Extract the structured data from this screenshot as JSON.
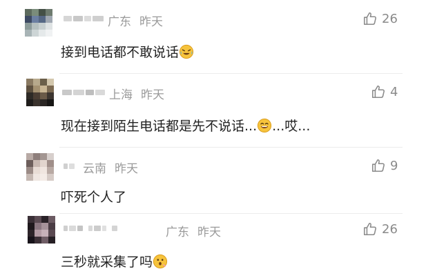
{
  "comments": [
    {
      "location": "广东",
      "time": "昨天",
      "likes": "26",
      "text": "接到电话都不敢说话",
      "emoji": "crying-laughing-emoji",
      "avatar_colors": [
        "#5d6b5e",
        "#7a8c7b",
        "#445046",
        "#6e7b6f",
        "#3d4a63",
        "#6b7fa2",
        "#566885",
        "#a0a8b2",
        "#8c9b9a",
        "#b5c0c0",
        "#c7cfd0",
        "#dfe3e4",
        "#a8b4b6",
        "#cdd5d6",
        "#e5e9ea",
        "#f0f2f3"
      ]
    },
    {
      "location": "上海",
      "time": "昨天",
      "likes": "4",
      "text_before": "现在接到陌生电话都是先不说话...",
      "text_after": "...哎...",
      "emoji": "laughing-emoji",
      "avatar_colors": [
        "#8a7a62",
        "#b7a98c",
        "#6b5f4a",
        "#d3c7ad",
        "#5e5140",
        "#a49171",
        "#c9b694",
        "#7c6a52",
        "#2e2a26",
        "#4a3d33",
        "#6a5a48",
        "#3c3530",
        "#1f1d1b",
        "#3a332d",
        "#2a2624",
        "#171615"
      ]
    },
    {
      "location": "云南",
      "time": "昨天",
      "likes": "9",
      "text": "吓死个人了",
      "emoji": "",
      "avatar_colors": [
        "#b8aaa5",
        "#8e7f7c",
        "#a39692",
        "#d7cfcc",
        "#6d5e5b",
        "#c9b9b2",
        "#e2d5ce",
        "#a08f8a",
        "#9b8b86",
        "#e8dcd5",
        "#f0e6e0",
        "#b9aaa4",
        "#c5b8b2",
        "#efe6e1",
        "#f4ece7",
        "#d6cbc6"
      ]
    },
    {
      "location": "广东",
      "time": "昨天",
      "likes": "26",
      "text": "三秒就采集了吗",
      "emoji": "hushed-face-emoji",
      "avatar_colors": [
        "#3a2f36",
        "#5a4a52",
        "#2a2228",
        "#6b5a62",
        "#1e181c",
        "#8a7680",
        "#a6929a",
        "#4a3c44",
        "#2d2429",
        "#b49ca5",
        "#c7b1b9",
        "#5b4a52",
        "#18131a",
        "#3c3037",
        "#6f5d66",
        "#261f24"
      ]
    }
  ]
}
